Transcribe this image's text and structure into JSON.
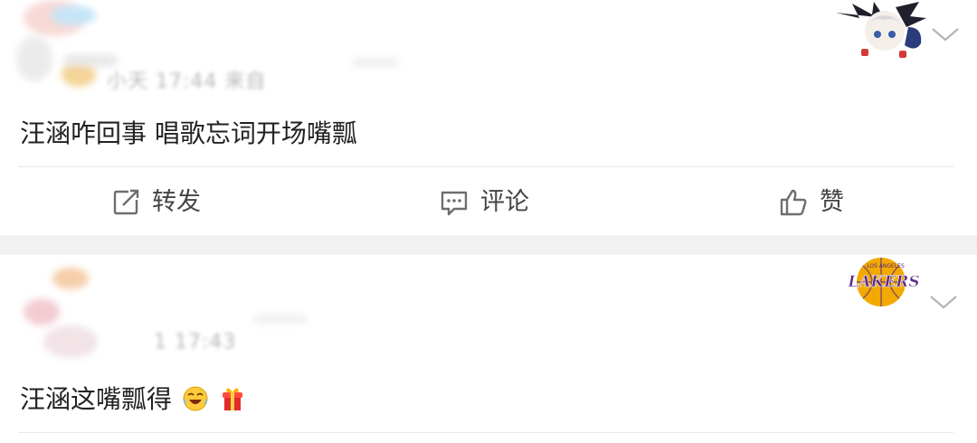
{
  "posts": [
    {
      "meta_text": "小天 17:44 来自",
      "content": "汪涵咋回事 唱歌忘词开场嘴瓢"
    },
    {
      "meta_text": "1 17:43",
      "content": "汪涵这嘴瓢得",
      "emojis": [
        "laughing-crying-emoji",
        "gift-emoji"
      ]
    }
  ],
  "actions": {
    "repost": "转发",
    "comment": "评论",
    "like": "赞"
  },
  "badges": {
    "badge1": "anime-character-badge",
    "badge2_text": "LAKERS",
    "badge2_small": "LOS ANGELES"
  },
  "colors": {
    "accent_purple": "#5b2a86",
    "accent_gold": "#f2a900",
    "separator": "#f1f1f1",
    "icon_gray": "#6e6e6e"
  }
}
